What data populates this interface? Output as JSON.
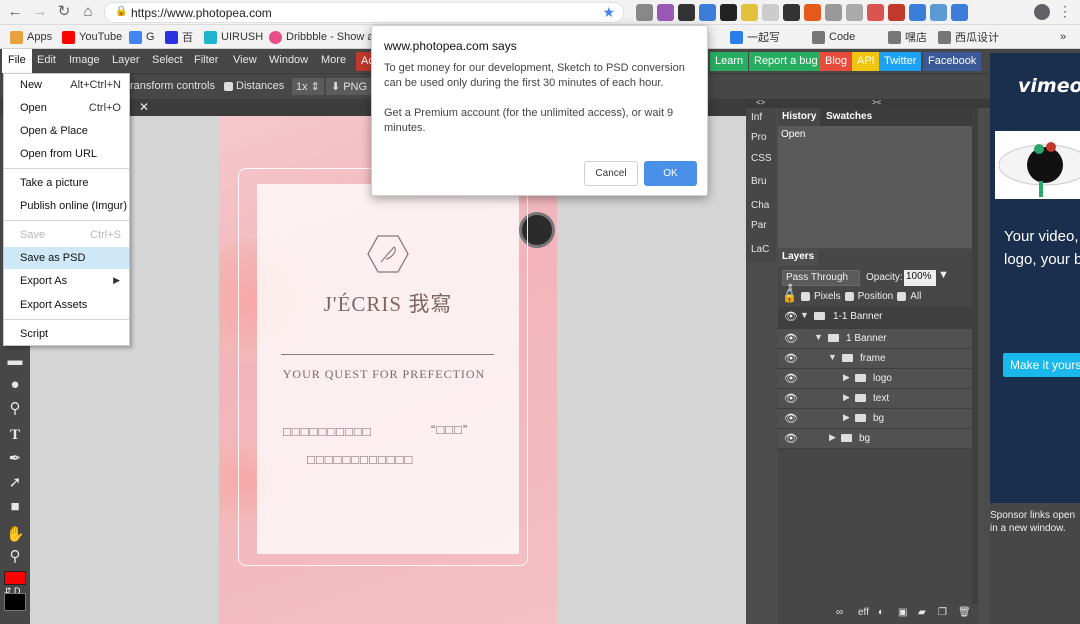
{
  "browser": {
    "url": "https://www.photopea.com",
    "bookmarks": [
      {
        "label": "Apps",
        "color": "#e6a23c"
      },
      {
        "label": "YouTube",
        "color": "#ff0000"
      },
      {
        "label": "G",
        "color": "#4285f4"
      },
      {
        "label": "百",
        "color": "#2932e1"
      },
      {
        "label": "UIRUSH",
        "color": "#1fb3d0"
      },
      {
        "label": "Dribbble - Show a...",
        "color": "#ea4c89"
      },
      {
        "label": "一起写",
        "color": "#2b7de9"
      },
      {
        "label": "Code",
        "color": "#666666"
      },
      {
        "label": "嘿店",
        "color": "#666666"
      },
      {
        "label": "西瓜设计",
        "color": "#666666"
      }
    ],
    "bookmarks_more": "»"
  },
  "menubar": {
    "items": [
      "File",
      "Edit",
      "Image",
      "Layer",
      "Select",
      "Filter",
      "View",
      "Window",
      "More"
    ],
    "hidden_item_fragment": "Ac",
    "ext_buttons": [
      {
        "label": "Learn",
        "color": "#27ae60"
      },
      {
        "label": "Report a bug",
        "color": "#27ae60"
      },
      {
        "label": "Blog",
        "color": "#e74c3c"
      },
      {
        "label": "API",
        "color": "#f1c40f"
      },
      {
        "label": "Twitter",
        "color": "#1da1f2"
      },
      {
        "label": "Facebook",
        "color": "#3b5998"
      }
    ]
  },
  "options": {
    "transform_controls": "ransform controls",
    "distances": "Distances",
    "zoom": "1x",
    "export_format": "PNG"
  },
  "file_menu": {
    "items": [
      {
        "label": "New",
        "shortcut": "Alt+Ctrl+N"
      },
      {
        "label": "Open",
        "shortcut": "Ctrl+O"
      },
      {
        "label": "Open & Place",
        "shortcut": ""
      },
      {
        "label": "Open from URL",
        "shortcut": ""
      },
      {
        "label": "Take a picture",
        "shortcut": ""
      },
      {
        "label": "Publish online (Imgur)",
        "shortcut": ""
      },
      {
        "label": "Save",
        "shortcut": "Ctrl+S"
      },
      {
        "label": "Save as PSD",
        "shortcut": ""
      },
      {
        "label": "Export As",
        "shortcut": ""
      },
      {
        "label": "Export Assets",
        "shortcut": ""
      },
      {
        "label": "Script",
        "shortcut": ""
      }
    ],
    "submenu_arrow": "▶"
  },
  "dialog": {
    "title": "www.photopea.com says",
    "message1": "To get money for our development, Sketch to PSD conversion can be used only during the first 30 minutes of each hour.",
    "message2": "Get a Premium account (for the unlimited access), or wait 9 minutes.",
    "cancel": "Cancel",
    "ok": "OK"
  },
  "artboard": {
    "brand": "J'ÉCRIS 我寫",
    "tagline": "YOUR QUEST FOR PREFECTION",
    "line1_left": "□□□□□□□□□□",
    "line1_right": "“□□□”",
    "line2": "□□□□□□□□□□□□"
  },
  "side_icons": [
    "Inf",
    "Pro",
    "CSS",
    "Bru",
    "Cha",
    "Par",
    "LaC"
  ],
  "history": {
    "tab_history": "History",
    "tab_swatches": "Swatches",
    "items": [
      "Open"
    ]
  },
  "layers": {
    "title": "Layers",
    "blend_mode": "Pass Through",
    "opacity_label": "Opacity:",
    "opacity_value": "100%",
    "lock_options": [
      "Pixels",
      "Position",
      "All"
    ],
    "rows": [
      {
        "name": "1-1 Banner"
      },
      {
        "name": "1 Banner"
      },
      {
        "name": "frame"
      },
      {
        "name": "logo"
      },
      {
        "name": "text"
      },
      {
        "name": "bg"
      },
      {
        "name": "bg"
      }
    ],
    "footer_eff": "eff"
  },
  "sponsor": {
    "brand": "vimeo",
    "headline": "Your video, your logo, your brand",
    "button": "Make it yours",
    "note": "Sponsor links open in a new window."
  },
  "colors": {
    "foreground": "#ff0000",
    "background": "#000000",
    "accent": "#4a90e8"
  }
}
